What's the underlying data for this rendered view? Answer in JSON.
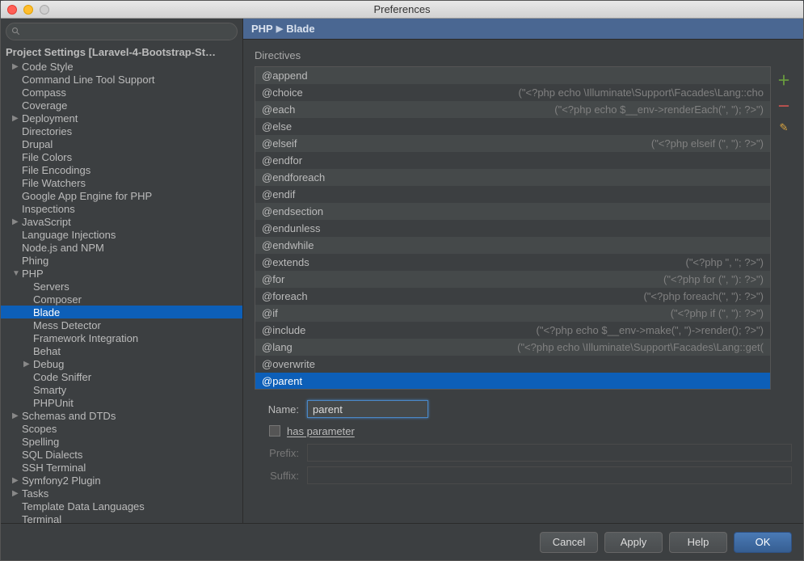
{
  "window": {
    "title": "Preferences"
  },
  "sidebar": {
    "search_placeholder": "",
    "project_header": "Project Settings [Laravel-4-Bootstrap-St…",
    "items": [
      {
        "label": "Code Style",
        "level": 1,
        "arrow": "▶"
      },
      {
        "label": "Command Line Tool Support",
        "level": 1,
        "arrow": ""
      },
      {
        "label": "Compass",
        "level": 1,
        "arrow": ""
      },
      {
        "label": "Coverage",
        "level": 1,
        "arrow": ""
      },
      {
        "label": "Deployment",
        "level": 1,
        "arrow": "▶"
      },
      {
        "label": "Directories",
        "level": 1,
        "arrow": ""
      },
      {
        "label": "Drupal",
        "level": 1,
        "arrow": ""
      },
      {
        "label": "File Colors",
        "level": 1,
        "arrow": ""
      },
      {
        "label": "File Encodings",
        "level": 1,
        "arrow": ""
      },
      {
        "label": "File Watchers",
        "level": 1,
        "arrow": ""
      },
      {
        "label": "Google App Engine for PHP",
        "level": 1,
        "arrow": ""
      },
      {
        "label": "Inspections",
        "level": 1,
        "arrow": ""
      },
      {
        "label": "JavaScript",
        "level": 1,
        "arrow": "▶"
      },
      {
        "label": "Language Injections",
        "level": 1,
        "arrow": ""
      },
      {
        "label": "Node.js and NPM",
        "level": 1,
        "arrow": ""
      },
      {
        "label": "Phing",
        "level": 1,
        "arrow": ""
      },
      {
        "label": "PHP",
        "level": 1,
        "arrow": "▼"
      },
      {
        "label": "Servers",
        "level": 2,
        "arrow": ""
      },
      {
        "label": "Composer",
        "level": 2,
        "arrow": ""
      },
      {
        "label": "Blade",
        "level": 2,
        "arrow": "",
        "selected": true
      },
      {
        "label": "Mess Detector",
        "level": 2,
        "arrow": ""
      },
      {
        "label": "Framework Integration",
        "level": 2,
        "arrow": ""
      },
      {
        "label": "Behat",
        "level": 2,
        "arrow": ""
      },
      {
        "label": "Debug",
        "level": 2,
        "arrow": "▶"
      },
      {
        "label": "Code Sniffer",
        "level": 2,
        "arrow": ""
      },
      {
        "label": "Smarty",
        "level": 2,
        "arrow": ""
      },
      {
        "label": "PHPUnit",
        "level": 2,
        "arrow": ""
      },
      {
        "label": "Schemas and DTDs",
        "level": 1,
        "arrow": "▶"
      },
      {
        "label": "Scopes",
        "level": 1,
        "arrow": ""
      },
      {
        "label": "Spelling",
        "level": 1,
        "arrow": ""
      },
      {
        "label": "SQL Dialects",
        "level": 1,
        "arrow": ""
      },
      {
        "label": "SSH Terminal",
        "level": 1,
        "arrow": ""
      },
      {
        "label": "Symfony2 Plugin",
        "level": 1,
        "arrow": "▶"
      },
      {
        "label": "Tasks",
        "level": 1,
        "arrow": "▶"
      },
      {
        "label": "Template Data Languages",
        "level": 1,
        "arrow": ""
      },
      {
        "label": "Terminal",
        "level": 1,
        "arrow": ""
      }
    ]
  },
  "breadcrumb": {
    "root": "PHP",
    "leaf": "Blade"
  },
  "directives": {
    "label": "Directives",
    "rows": [
      {
        "name": "@append",
        "hint": ""
      },
      {
        "name": "@choice",
        "hint": "(\"<?php echo \\Illuminate\\Support\\Facades\\Lang::cho"
      },
      {
        "name": "@each",
        "hint": "(\"<?php echo $__env->renderEach(\", \"); ?>\")"
      },
      {
        "name": "@else",
        "hint": ""
      },
      {
        "name": "@elseif",
        "hint": "(\"<?php elseif (\", \"): ?>\")"
      },
      {
        "name": "@endfor",
        "hint": ""
      },
      {
        "name": "@endforeach",
        "hint": ""
      },
      {
        "name": "@endif",
        "hint": ""
      },
      {
        "name": "@endsection",
        "hint": ""
      },
      {
        "name": "@endunless",
        "hint": ""
      },
      {
        "name": "@endwhile",
        "hint": ""
      },
      {
        "name": "@extends",
        "hint": "(\"<?php \", \"; ?>\")"
      },
      {
        "name": "@for",
        "hint": "(\"<?php for (\", \"): ?>\")"
      },
      {
        "name": "@foreach",
        "hint": "(\"<?php foreach(\", \"): ?>\")"
      },
      {
        "name": "@if",
        "hint": "(\"<?php if (\", \"): ?>\")"
      },
      {
        "name": "@include",
        "hint": "(\"<?php echo $__env->make(\", \")->render(); ?>\")"
      },
      {
        "name": "@lang",
        "hint": "(\"<?php echo \\Illuminate\\Support\\Facades\\Lang::get("
      },
      {
        "name": "@overwrite",
        "hint": ""
      },
      {
        "name": "@parent",
        "hint": "",
        "selected": true
      }
    ]
  },
  "form": {
    "name_label": "Name:",
    "name_value": "parent",
    "has_parameter_label": "has parameter",
    "prefix_label": "Prefix:",
    "suffix_label": "Suffix:"
  },
  "footer": {
    "cancel": "Cancel",
    "apply": "Apply",
    "help": "Help",
    "ok": "OK"
  }
}
